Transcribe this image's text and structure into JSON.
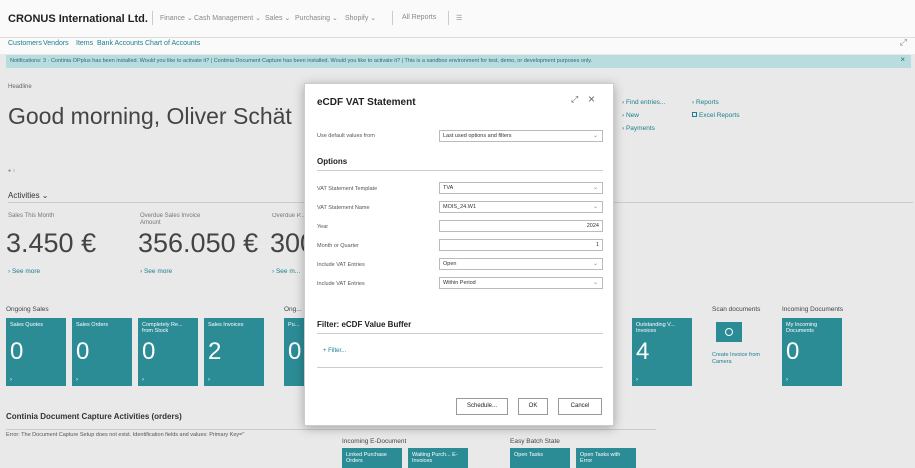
{
  "app": {
    "company": "CRONUS International Ltd.",
    "nav": [
      "Finance ⌄",
      "Cash Management ⌄",
      "Sales ⌄",
      "Purchasing ⌄",
      "Shopify ⌄",
      "All Reports",
      "☰"
    ]
  },
  "links": [
    "Customers",
    "Vendors",
    "Items",
    "Bank Accounts",
    "Chart of Accounts"
  ],
  "notification": {
    "text": "Notifications: 3 · Continia OPplus has been installed. Would you like to activate it? | Continia Document Capture has been installed. Would you like to activate it? | This is a sandbox environment for test, demo, or development purposes only.",
    "close": "×"
  },
  "headline": {
    "label": "Headline",
    "greeting": "Good morning, Oliver Schät",
    "dots": "● ○"
  },
  "actions": {
    "col1": [
      "› Find entries...",
      "› New",
      "› Payments"
    ],
    "col2": [
      "› Reports",
      "Excel Reports"
    ]
  },
  "activities": {
    "title": "Activities ⌄",
    "kpis": [
      {
        "label": "Sales This Month",
        "value": "3.450 €",
        "more": "› See more"
      },
      {
        "label": "Overdue Sales Invoice Amount",
        "value": "356.050 €",
        "more": "› See more"
      },
      {
        "label": "Overdue P... Amount",
        "value": "300",
        "more": "› See m..."
      }
    ]
  },
  "ongoing_sales": {
    "title": "Ongoing Sales",
    "tiles": [
      {
        "label": "Sales Quotes",
        "value": "0"
      },
      {
        "label": "Sales Orders",
        "value": "0"
      },
      {
        "label": "Completely Re... from Stock",
        "value": "0"
      },
      {
        "label": "Sales Invoices",
        "value": "2"
      }
    ]
  },
  "ongoing_purchases": {
    "title": "Ong...",
    "tiles": [
      {
        "label": "Pu...",
        "value": "0"
      }
    ]
  },
  "right_tiles": {
    "outstanding": {
      "label": "Outstanding V... Invoices",
      "value": "4"
    },
    "scan": {
      "title": "Scan documents",
      "label": "Create Invoice from Camera"
    },
    "incoming": {
      "title": "Incoming Documents",
      "label": "My Incoming Documents",
      "value": "0"
    }
  },
  "continia": {
    "title": "Continia Document Capture Activities (orders)",
    "error": "Error: The Document Capture Setup does not exist. Identification fields and values: Primary Key=''",
    "incoming_title": "Incoming E-Document",
    "incoming_tiles": [
      "Linked Purchase Orders",
      "Waiting Purch... E-Invoices"
    ],
    "batch_title": "Easy Batch State",
    "batch_tiles": [
      "Open Tasks",
      "Open Tasks with Error"
    ]
  },
  "dialog": {
    "title": "eCDF VAT Statement",
    "default_label": "Use default values from",
    "default_value": "Last used options and filters",
    "options_title": "Options",
    "fields": [
      {
        "label": "VAT Statement Template",
        "value": "TVA"
      },
      {
        "label": "VAT Statement Name",
        "value": "MOIS_24.W1"
      },
      {
        "label": "Year",
        "value": "2024"
      },
      {
        "label": "Month or Quarter",
        "value": "1"
      },
      {
        "label": "Include VAT Entries",
        "value": "Open"
      },
      {
        "label": "Include VAT Entries",
        "value": "Within Period"
      }
    ],
    "filter_title": "Filter: eCDF Value Buffer",
    "filter_link": "+ Filter...",
    "buttons": {
      "schedule": "Schedule...",
      "ok": "OK",
      "cancel": "Cancel"
    }
  }
}
